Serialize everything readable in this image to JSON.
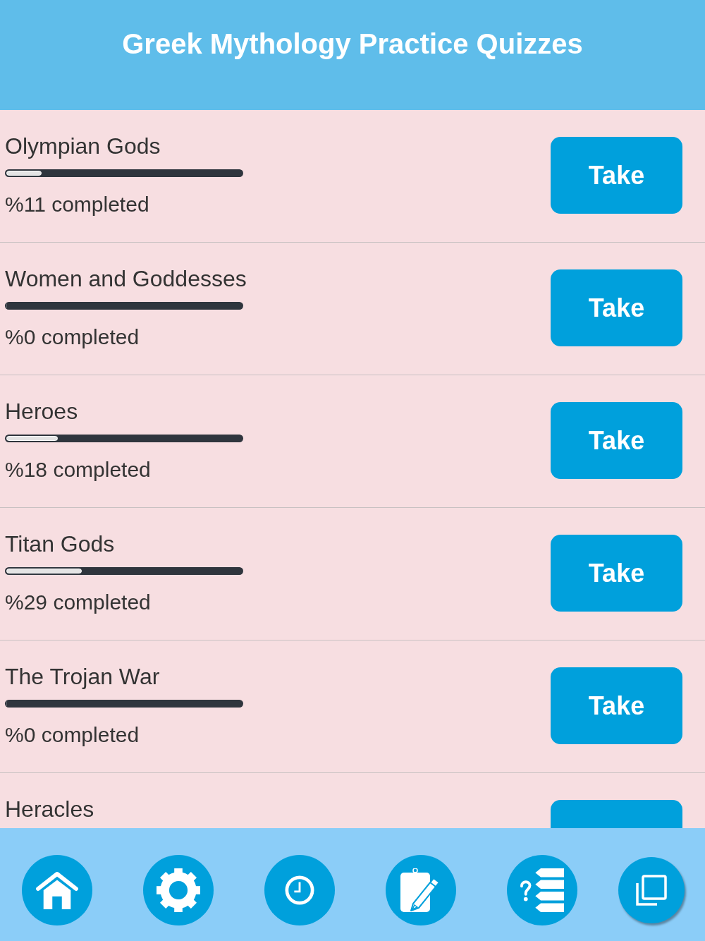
{
  "header": {
    "title": "Greek Mythology Practice Quizzes"
  },
  "quizzes": [
    {
      "title": "Olympian Gods",
      "level": 0.15,
      "progress_text": "%11 completed",
      "button": "Take"
    },
    {
      "title": "Women and Goddesses",
      "level": 0,
      "progress_text": "%0 completed",
      "button": "Take"
    },
    {
      "title": "Heroes",
      "level": 0.22,
      "progress_text": "%18 completed",
      "button": "Take"
    },
    {
      "title": "Titan Gods",
      "level": 0.32,
      "progress_text": "%29 completed",
      "button": "Take"
    },
    {
      "title": "The Trojan War",
      "level": 0,
      "progress_text": "%0 completed",
      "button": "Take"
    },
    {
      "title": "Heracles"
    }
  ],
  "nav": [
    {
      "kind": "home"
    },
    {
      "kind": "settings"
    },
    {
      "kind": "history"
    },
    {
      "kind": "notes"
    },
    {
      "kind": "quiz"
    },
    {
      "kind": "copy"
    }
  ]
}
